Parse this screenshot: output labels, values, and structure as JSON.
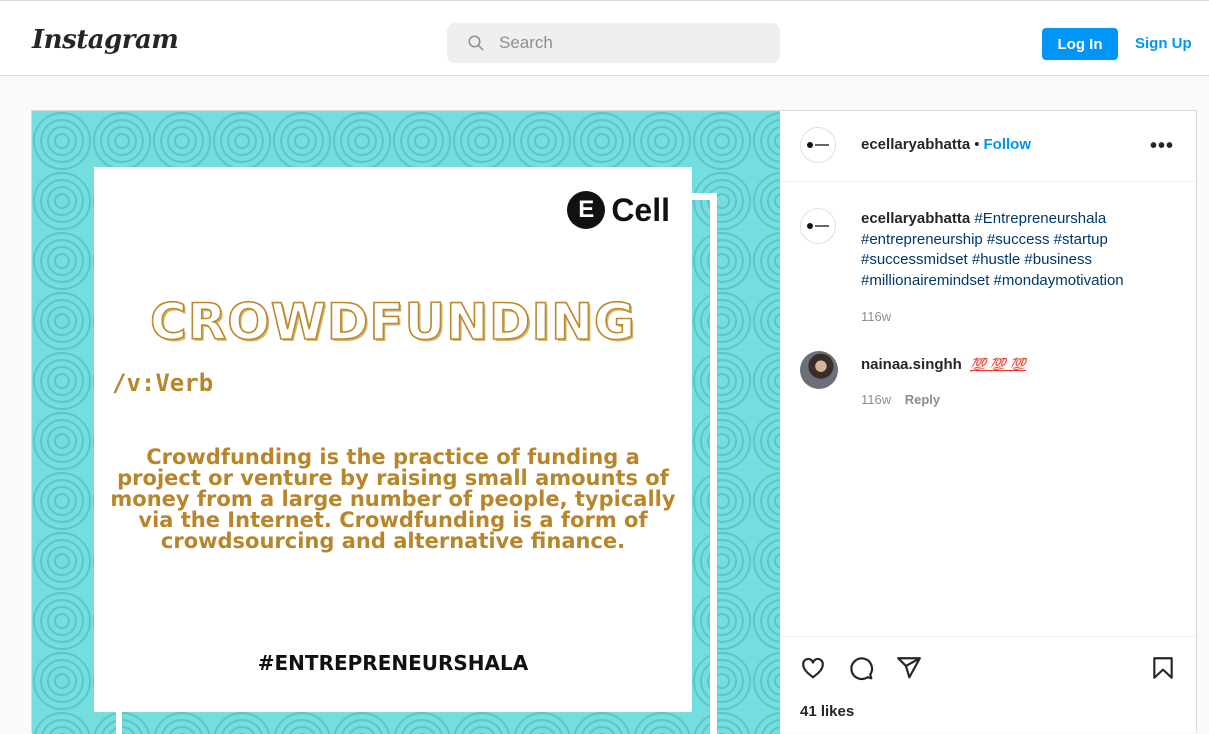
{
  "header": {
    "logo": "Instagram",
    "search_placeholder": "Search",
    "login_label": "Log In",
    "signup_label": "Sign Up"
  },
  "post_image": {
    "brand_letter": "E",
    "brand_word": "Cell",
    "headline": "CROWDFUNDING",
    "part_of_speech": "/v:Verb",
    "definition": "Crowdfunding is the practice of funding a project or venture by raising small amounts of money from a large number of people, typically via the Internet. Crowdfunding is a form of crowdsourcing and alternative finance.",
    "hashtag": "#ENTREPRENEURSHALA"
  },
  "post": {
    "author": "ecellaryabhatta",
    "separator": "•",
    "follow_label": "Follow",
    "more_label": "•••",
    "caption_author": "ecellaryabhatta",
    "caption_tags": "#Entrepreneurshala #entrepreneurship #success #startup #successmidset #hustle #business #millionairemindset #mondaymotivation",
    "caption_time": "116w",
    "comments": [
      {
        "user": "nainaa.singhh",
        "text": "💯 💯 💯",
        "time": "116w",
        "reply_label": "Reply"
      }
    ],
    "likes": "41 likes"
  },
  "icons": [
    "search-icon",
    "heart-icon",
    "comment-icon",
    "share-icon",
    "bookmark-icon",
    "more-icon"
  ],
  "colors": {
    "accent": "#0095f6",
    "media_bg": "#74dede",
    "gold_text": "#b8862a"
  }
}
